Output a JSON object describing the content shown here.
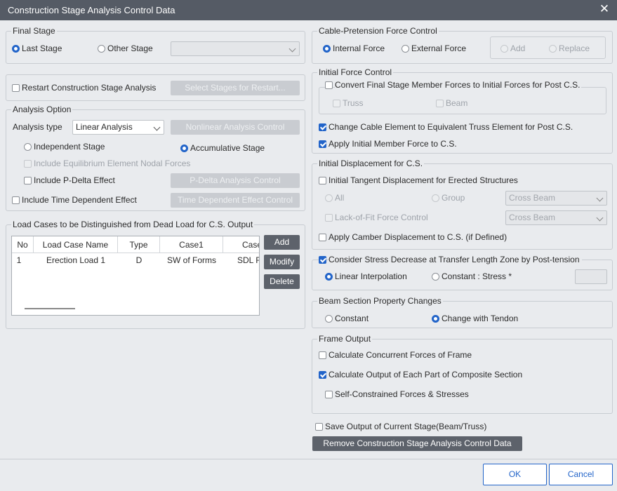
{
  "window": {
    "title": "Construction Stage Analysis Control Data"
  },
  "final_stage": {
    "legend": "Final Stage",
    "last_stage": "Last Stage",
    "other_stage": "Other Stage",
    "selected": "last_stage"
  },
  "restart": {
    "label": "Restart Construction Stage Analysis",
    "checked": false,
    "select_button": "Select Stages for Restart..."
  },
  "analysis_option": {
    "legend": "Analysis Option",
    "type_label": "Analysis type",
    "type_value": "Linear Analysis",
    "nonlinear_button": "Nonlinear Analysis Control",
    "independent_stage": "Independent Stage",
    "accumulative_stage": "Accumulative Stage",
    "selected_stage_mode": "accumulative",
    "include_equilibrium": "Include Equilibrium Element Nodal Forces",
    "include_pdelta": "Include P-Delta Effect",
    "pdelta_button": "P-Delta Analysis Control",
    "include_time_dependent": "Include Time Dependent Effect",
    "time_dependent_button": "Time Dependent Effect Control"
  },
  "load_cases": {
    "legend": "Load Cases to be Distinguished from Dead Load for C.S. Output",
    "columns": [
      "No",
      "Load Case Name",
      "Type",
      "Case1",
      "Case"
    ],
    "rows": [
      {
        "no": "1",
        "name": "Erection Load 1",
        "type": "D",
        "case1": "SW of Forms",
        "case2": "SDL F"
      }
    ],
    "add_button": "Add",
    "modify_button": "Modify",
    "delete_button": "Delete"
  },
  "cable_pretension": {
    "legend": "Cable-Pretension Force Control",
    "internal": "Internal Force",
    "external": "External Force",
    "selected": "internal",
    "add": "Add",
    "replace": "Replace"
  },
  "initial_force": {
    "legend": "Initial Force Control",
    "convert_label": "Convert Final Stage Member Forces to Initial Forces for Post C.S.",
    "truss": "Truss",
    "beam": "Beam",
    "change_cable": "Change Cable Element to Equivalent Truss Element for Post C.S.",
    "apply_initial": "Apply Initial Member Force to C.S."
  },
  "initial_displacement": {
    "legend": "Initial Displacement for C.S.",
    "tangent": "Initial Tangent Displacement for Erected Structures",
    "all": "All",
    "group": "Group",
    "group_value": "Cross Beam",
    "lack_of_fit": "Lack-of-Fit Force Control",
    "lack_value": "Cross Beam",
    "camber": "Apply Camber Displacement to C.S. (if Defined)"
  },
  "stress_decrease": {
    "label": "Consider Stress Decrease at Transfer Length Zone by Post-tension",
    "linear": "Linear Interpolation",
    "constant": "Constant : Stress *",
    "constant_value": ""
  },
  "beam_section": {
    "legend": "Beam Section Property Changes",
    "constant": "Constant",
    "change_with_tendon": "Change with Tendon",
    "selected": "change_with_tendon"
  },
  "frame_output": {
    "legend": "Frame Output",
    "concurrent": "Calculate Concurrent Forces of Frame",
    "composite": "Calculate Output of Each Part of Composite Section",
    "self_constrained": "Self-Constrained Forces & Stresses"
  },
  "save_output": "Save Output of Current Stage(Beam/Truss)",
  "remove_button": "Remove Construction Stage Analysis Control Data",
  "ok_button": "OK",
  "cancel_button": "Cancel",
  "colors": {
    "title_bar": "#555b65",
    "accent": "#2264c9",
    "background": "#e9ebee"
  }
}
